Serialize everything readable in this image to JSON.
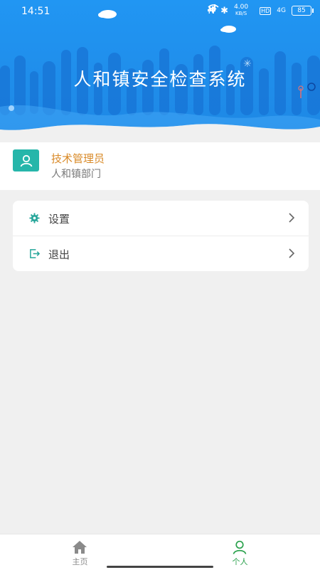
{
  "status_bar": {
    "time": "14:51",
    "net_speed": "4.00",
    "net_unit": "KB/S",
    "hd_label": "HD",
    "signal_label": "4G",
    "battery": "85"
  },
  "header": {
    "title": "人和镇安全检查系统"
  },
  "profile": {
    "name": "技术管理员",
    "department": "人和镇部门"
  },
  "menu": {
    "items": [
      {
        "label": "设置",
        "icon": "gear-icon"
      },
      {
        "label": "退出",
        "icon": "logout-icon"
      }
    ]
  },
  "tabbar": {
    "tabs": [
      {
        "label": "主页",
        "icon": "home-icon",
        "active": false
      },
      {
        "label": "个人",
        "icon": "person-icon",
        "active": true
      }
    ]
  },
  "colors": {
    "header_blue": "#1f8ff0",
    "accent_teal": "#26b6aa",
    "user_name": "#d98a28",
    "tab_active": "#2aa14c",
    "tab_inactive": "#8a8a8a"
  }
}
